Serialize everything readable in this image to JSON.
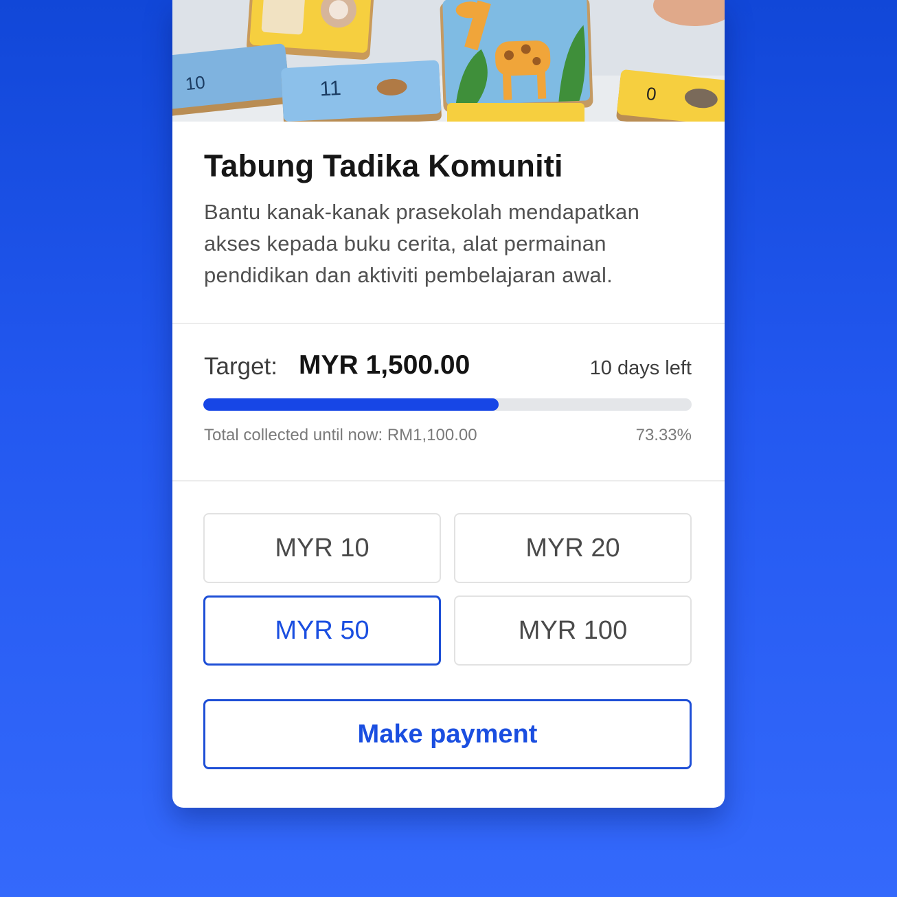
{
  "campaign": {
    "title": "Tabung Tadika Komuniti",
    "description": "Bantu kanak-kanak prasekolah mendapatkan akses kepada buku cerita, alat permainan pendidikan dan aktiviti pembelajaran awal.",
    "image_alt": "Preschool animal puzzle cards on a table"
  },
  "progress": {
    "target_label": "Target:",
    "target_amount": "MYR 1,500.00",
    "days_left": "10 days left",
    "collected_text": "Total collected until now: RM1,100.00",
    "percent_text": "73.33%",
    "fraction": 0.7333
  },
  "amounts": [
    {
      "label": "MYR 10",
      "selected": false
    },
    {
      "label": "MYR 20",
      "selected": false
    },
    {
      "label": "MYR 50",
      "selected": true
    },
    {
      "label": "MYR 100",
      "selected": false
    }
  ],
  "payment": {
    "button_label": "Make payment"
  },
  "colors": {
    "accent": "#1e4fd6",
    "background": "#1f55ec",
    "progress_track": "#e4e6e9"
  }
}
